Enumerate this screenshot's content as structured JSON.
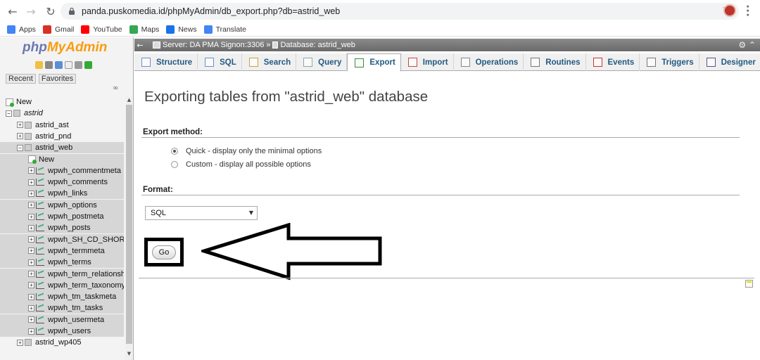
{
  "browser": {
    "url": "panda.puskomedia.id/phpMyAdmin/db_export.php?db=astrid_web",
    "bookmarks": [
      {
        "label": "Apps",
        "color": "#4285f4"
      },
      {
        "label": "Gmail",
        "color": "#d93025"
      },
      {
        "label": "YouTube",
        "color": "#ff0000"
      },
      {
        "label": "Maps",
        "color": "#34a853"
      },
      {
        "label": "News",
        "color": "#1a73e8"
      },
      {
        "label": "Translate",
        "color": "#4285f4"
      }
    ]
  },
  "sidebar": {
    "logo_php": "php",
    "logo_myadmin": "MyAdmin",
    "recent_label": "Recent",
    "favorites_label": "Favorites",
    "tree": [
      {
        "label": "New",
        "kind": "new",
        "level": 0
      },
      {
        "label": "astrid",
        "kind": "server",
        "level": 0
      },
      {
        "label": "astrid_ast",
        "kind": "db",
        "level": 1
      },
      {
        "label": "astrid_pnd",
        "kind": "db",
        "level": 1
      },
      {
        "label": "astrid_web",
        "kind": "db",
        "level": 1,
        "selected": true
      },
      {
        "label": "New",
        "kind": "new",
        "level": 2,
        "selected": true
      },
      {
        "label": "wpwh_commentmeta",
        "kind": "table",
        "level": 2,
        "selected": true
      },
      {
        "label": "wpwh_comments",
        "kind": "table",
        "level": 2,
        "selected": true
      },
      {
        "label": "wpwh_links",
        "kind": "table",
        "level": 2,
        "selected": true
      },
      {
        "label": "wpwh_options",
        "kind": "table",
        "level": 2,
        "selected": true
      },
      {
        "label": "wpwh_postmeta",
        "kind": "table",
        "level": 2,
        "selected": true
      },
      {
        "label": "wpwh_posts",
        "kind": "table",
        "level": 2,
        "selected": true
      },
      {
        "label": "wpwh_SH_CD_SHORT",
        "kind": "table",
        "level": 2,
        "selected": true
      },
      {
        "label": "wpwh_termmeta",
        "kind": "table",
        "level": 2,
        "selected": true
      },
      {
        "label": "wpwh_terms",
        "kind": "table",
        "level": 2,
        "selected": true
      },
      {
        "label": "wpwh_term_relationshi",
        "kind": "table",
        "level": 2,
        "selected": true
      },
      {
        "label": "wpwh_term_taxonomy",
        "kind": "table",
        "level": 2,
        "selected": true
      },
      {
        "label": "wpwh_tm_taskmeta",
        "kind": "table",
        "level": 2,
        "selected": true
      },
      {
        "label": "wpwh_tm_tasks",
        "kind": "table",
        "level": 2,
        "selected": true
      },
      {
        "label": "wpwh_usermeta",
        "kind": "table",
        "level": 2,
        "selected": true
      },
      {
        "label": "wpwh_users",
        "kind": "table",
        "level": 2,
        "selected": true
      },
      {
        "label": "astrid_wp405",
        "kind": "db",
        "level": 1
      }
    ]
  },
  "breadcrumb": {
    "server": "Server: DA PMA Signon:3306 »",
    "database": "Database: astrid_web"
  },
  "menu": [
    {
      "label": "Structure",
      "icon": "structure-icon",
      "active": false
    },
    {
      "label": "SQL",
      "icon": "sql-icon",
      "active": false
    },
    {
      "label": "Search",
      "icon": "search-icon",
      "active": false
    },
    {
      "label": "Query",
      "icon": "query-icon",
      "active": false
    },
    {
      "label": "Export",
      "icon": "export-icon",
      "active": true
    },
    {
      "label": "Import",
      "icon": "import-icon",
      "active": false
    },
    {
      "label": "Operations",
      "icon": "wrench-icon",
      "active": false
    },
    {
      "label": "Routines",
      "icon": "routines-icon",
      "active": false
    },
    {
      "label": "Events",
      "icon": "clock-icon",
      "active": false
    },
    {
      "label": "Triggers",
      "icon": "triggers-icon",
      "active": false
    },
    {
      "label": "Designer",
      "icon": "designer-icon",
      "active": false
    }
  ],
  "main": {
    "title": "Exporting tables from \"astrid_web\" database",
    "export_method_label": "Export method:",
    "quick_option": "Quick - display only the minimal options",
    "custom_option": "Custom - display all possible options",
    "format_label": "Format:",
    "format_value": "SQL",
    "go_label": "Go"
  }
}
